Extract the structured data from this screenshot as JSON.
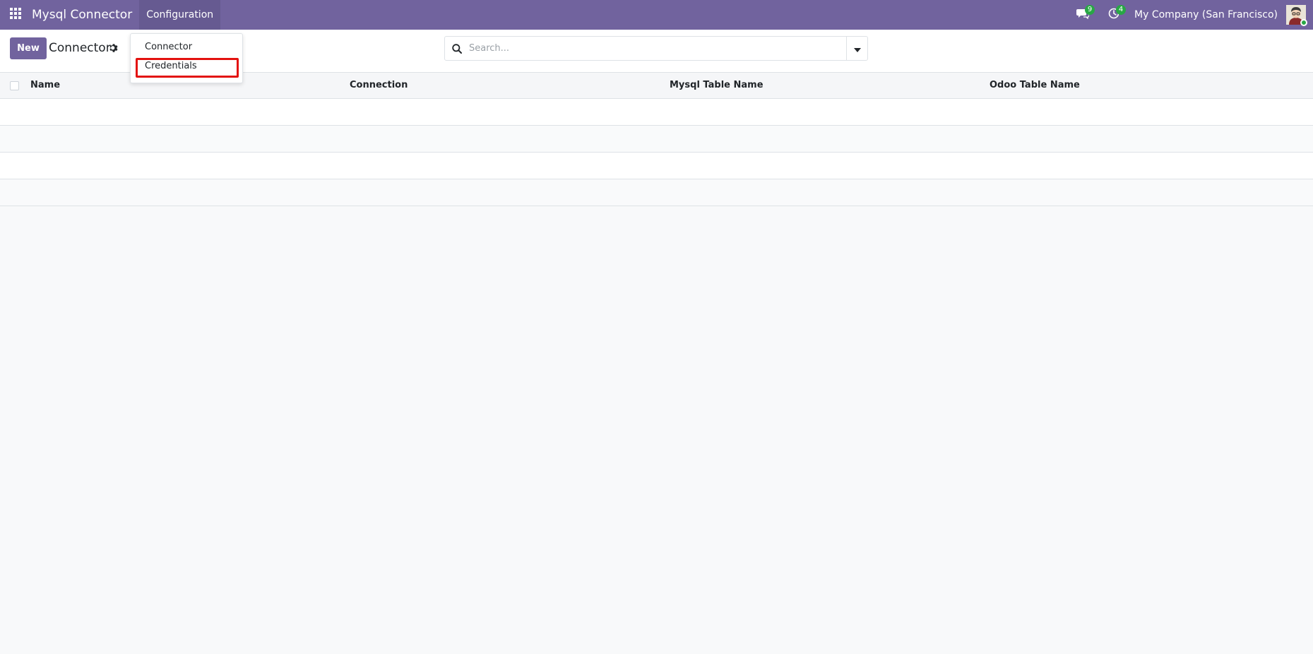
{
  "navbar": {
    "app_name": "Mysql Connector",
    "menu": "Configuration",
    "messages_count": "9",
    "activities_count": "4",
    "company": "My Company (San Francisco)",
    "bg_color": "#71639e"
  },
  "control": {
    "new_label": "New",
    "breadcrumb": "Connector",
    "search_placeholder": "Search..."
  },
  "dropdown": {
    "items": [
      {
        "label": "Connector"
      },
      {
        "label": "Credentials",
        "highlighted": true
      }
    ]
  },
  "table": {
    "columns": [
      "Name",
      "Connection",
      "Mysql Table Name",
      "Odoo Table Name"
    ],
    "rows": []
  },
  "icons": {
    "apps": "grid-icon",
    "messages": "chat-bubble-icon",
    "activities": "clock-icon",
    "settings": "gear-icon",
    "search": "magnifier-icon",
    "toggle": "caret-down-icon"
  },
  "colors": {
    "accent": "#71639e",
    "badge": "#28a745",
    "highlight_border": "#e3120f"
  }
}
